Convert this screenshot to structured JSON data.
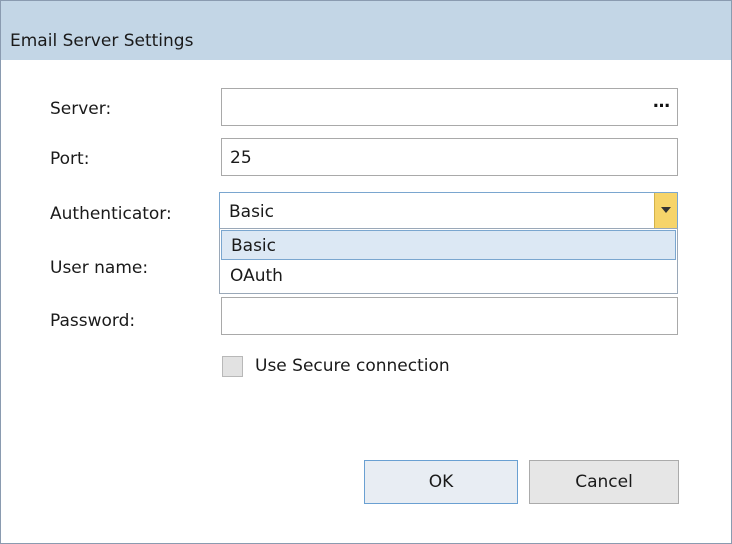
{
  "dialog": {
    "title": "Email Server Settings"
  },
  "form": {
    "server": {
      "label": "Server:",
      "value": "",
      "browse_label": "…"
    },
    "port": {
      "label": "Port:",
      "value": "25"
    },
    "authenticator": {
      "label": "Authenticator:",
      "value": "Basic",
      "options": [
        "Basic",
        "OAuth"
      ],
      "highlighted_option": "Basic"
    },
    "username": {
      "label": "User name:",
      "value": ""
    },
    "password": {
      "label": "Password:",
      "value": ""
    },
    "secure_connection": {
      "label": "Use Secure connection",
      "checked": false
    }
  },
  "buttons": {
    "ok": "OK",
    "cancel": "Cancel"
  },
  "colors": {
    "titlebar": "#c3d6e6",
    "combo_arrow": "#f6d46a",
    "selection": "#dce8f4",
    "focus_border": "#7aa6cf"
  }
}
